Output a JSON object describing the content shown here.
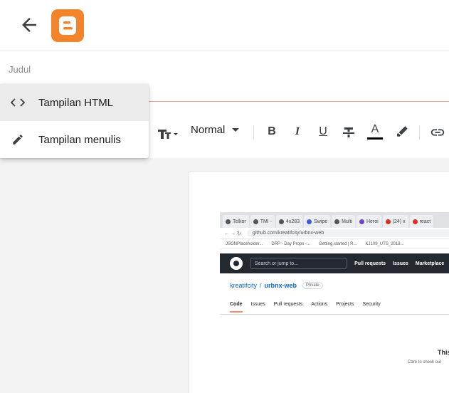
{
  "app": {
    "back_icon": "arrow-back-icon",
    "logo_icon": "blogger-logo-icon",
    "brand_color": "#f2842c"
  },
  "post": {
    "title_label": "Judul"
  },
  "menu": {
    "items": [
      {
        "label": "Tampilan HTML",
        "icon": "code-icon",
        "selected": true
      },
      {
        "label": "Tampilan menulis",
        "icon": "pencil-icon",
        "selected": false
      }
    ]
  },
  "toolbar": {
    "font_size_icon": "font-size-icon",
    "paragraph_style": "Normal",
    "bold_label": "B",
    "italic_label": "I",
    "underline_label": "U",
    "text_color_label": "A",
    "strikethrough_icon": "strikethrough-icon",
    "highlight_icon": "highlighter-icon",
    "link_icon": "link-icon"
  },
  "screenshot": {
    "tabs": [
      "Telkor",
      "TMI -",
      "4x283",
      "Swipe",
      "Multi",
      "Heroi",
      "(24) x",
      "react"
    ],
    "url": "github.com/kreatifcity/urbnx-web",
    "bookmarks": [
      "JSONPlaceholder...",
      "DRP - Day Props -...",
      "Getting started | R...",
      "KJ109_UTS_2018..."
    ],
    "search_placeholder": "Search or jump to...",
    "nav": [
      "Pull requests",
      "Issues",
      "Marketplace",
      "E"
    ],
    "repo_owner": "kreatifcity",
    "repo_sep": "/",
    "repo_name": "urbnx-web",
    "repo_visibility": "Private",
    "repo_tabs": [
      "Code",
      "Issues",
      "Pull requests",
      "Actions",
      "Projects",
      "Security"
    ],
    "heading_fragment": "This",
    "sub_fragment": "Care to check out"
  }
}
